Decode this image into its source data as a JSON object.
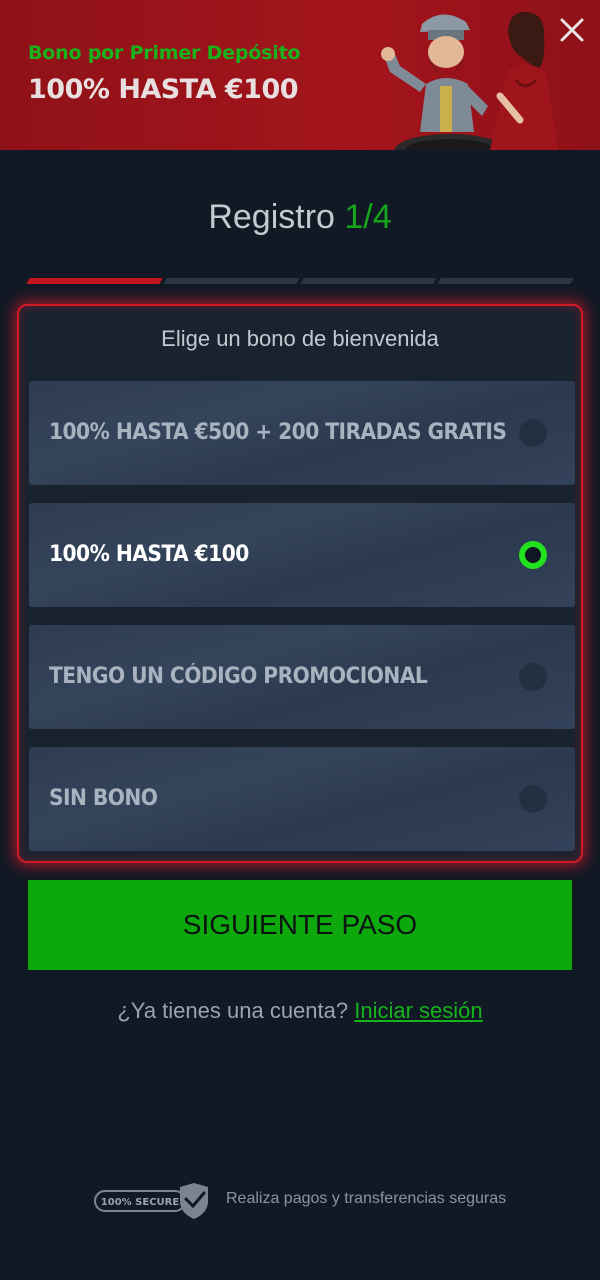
{
  "banner": {
    "subtitle": "Bono por Primer Depósito",
    "title": "100% HASTA €100"
  },
  "registration": {
    "title": "Registro",
    "step": "1/4",
    "progress": {
      "current_step": 1,
      "total_steps": 4
    }
  },
  "bonus_panel": {
    "heading": "Elige un bono de bienvenida",
    "options": [
      {
        "label": "100% HASTA €500 + 200 TIRADAS GRATIS",
        "selected": false
      },
      {
        "label": "100% HASTA €100",
        "selected": true
      },
      {
        "label": "TENGO UN CÓDIGO PROMOCIONAL",
        "selected": false
      },
      {
        "label": "SIN BONO",
        "selected": false
      }
    ]
  },
  "next_button": {
    "label": "SIGUIENTE PASO"
  },
  "login_prompt": {
    "text": "¿Ya tienes una cuenta?",
    "link": "Iniciar sesión"
  },
  "footer": {
    "badge": "100% SECURE",
    "text": "Realiza pagos y transferencias seguras"
  },
  "colors": {
    "accent_green": "#17a51b",
    "selected_radio": "#22e11e",
    "banner_red": "#a4141c",
    "panel_border": "#d21a27",
    "background": "#111925"
  }
}
